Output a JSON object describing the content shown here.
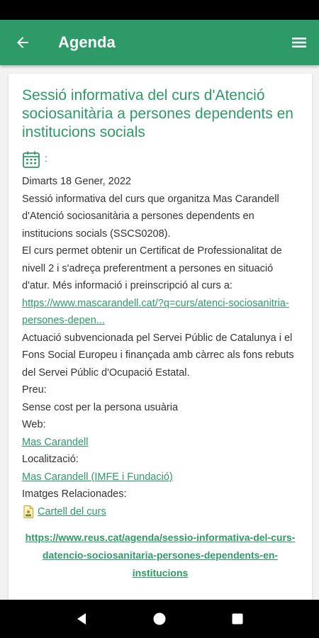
{
  "header": {
    "title": "Agenda",
    "color": "#2e9a67",
    "back_icon": "arrow-left-icon",
    "menu_icon": "hamburger-menu-icon"
  },
  "event": {
    "title": "Sessió informativa del curs d'Atenció sociosanitària a persones dependents en institucions socials",
    "date_icon": "calendar-icon",
    "date_separator": ":",
    "date": "Dimarts 18 Gener, 2022",
    "description_1": "Sessió informativa del curs que organitza Mas Carandell d'Atenció sociosanitària a persones dependents en institucions socials (SSCS0208).",
    "description_2_prefix": "El curs permet obtenir un Certificat de Professionalitat de nivell 2 i s'adreça preferentment a persones en situació d'atur. Més informació i preinscripció al curs a: ",
    "description_2_link": "https://www.mascarandell.cat/?q=curs/atenci-sociosanitria-persones-depen...",
    "description_3": "Actuació subvencionada pel Servei Públic de Catalunya i el Fons Social Europeu i finançada amb càrrec als fons rebuts del Servei Públic d'Ocupació Estatal.",
    "price_label": "Preu:",
    "price_value": "Sense cost per la persona usuària",
    "web_label": "Web:",
    "web_link": "Mas Carandell",
    "location_label": "Localització:",
    "location_link": "Mas Carandell (IMFE i Fundació)",
    "images_label": "Imatges Relacionades:",
    "image_icon": "image-file-icon",
    "image_link": "Cartell del curs",
    "footer_url": "https://www.reus.cat/agenda/sessio-informativa-del-curs-datencio-sociosanitaria-persones-dependents-en-institucions"
  },
  "nav": {
    "back_icon": "nav-back-triangle-icon",
    "home_icon": "nav-home-circle-icon",
    "recents_icon": "nav-recents-square-icon"
  }
}
